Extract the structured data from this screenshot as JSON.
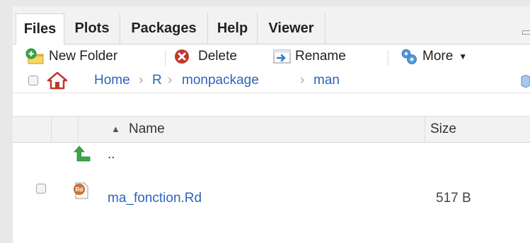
{
  "tabs": [
    {
      "label": "Files",
      "active": true
    },
    {
      "label": "Plots",
      "active": false
    },
    {
      "label": "Packages",
      "active": false
    },
    {
      "label": "Help",
      "active": false
    },
    {
      "label": "Viewer",
      "active": false
    }
  ],
  "toolbar": {
    "new_folder": "New Folder",
    "delete": "Delete",
    "rename": "Rename",
    "more": "More"
  },
  "breadcrumb": [
    "Home",
    "R",
    "monpackage",
    "man"
  ],
  "table": {
    "columns": {
      "name": "Name",
      "size": "Size"
    },
    "sort": "ascending",
    "parent_label": "..",
    "files": [
      {
        "name": "ma_fonction.Rd",
        "size": "517 B",
        "icon": "rd-file-icon"
      }
    ]
  },
  "colors": {
    "link": "#2f65ba",
    "tab_background": "#f2f2f2",
    "delete_red": "#c0392b",
    "up_arrow_green": "#3aa64a"
  }
}
